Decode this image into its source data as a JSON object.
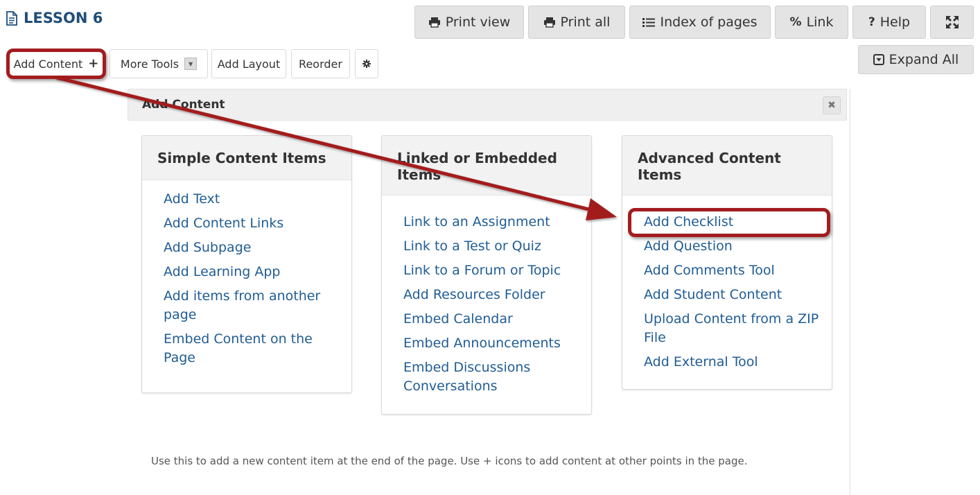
{
  "page": {
    "title": "LESSON 6"
  },
  "top_buttons": [
    {
      "label": "Print view"
    },
    {
      "label": "Print all"
    },
    {
      "label": "Index of pages"
    },
    {
      "label": "Link"
    },
    {
      "label": "Help"
    },
    {
      "label": "",
      "icon": "fullscreen-icon"
    }
  ],
  "toolbar": {
    "add_content": "Add Content",
    "more_tools": "More Tools",
    "add_layout": "Add Layout",
    "reorder": "Reorder",
    "settings_icon": "gear-icon",
    "expand_all": "Expand All"
  },
  "panel": {
    "title": "Add Content",
    "close_icon": "close-icon",
    "hint": "Use this to add a new content item at the end of the page. Use + icons to add content at other points in the page."
  },
  "columns": [
    {
      "title": "Simple Content Items",
      "items": [
        "Add Text",
        "Add Content Links",
        "Add Subpage",
        "Add Learning App",
        "Add items from another page",
        "Embed Content on the Page"
      ]
    },
    {
      "title": "Linked or Embedded Items",
      "items": [
        "Link to an Assignment",
        "Link to a Test or Quiz",
        "Link to a Forum or Topic",
        "Add Resources Folder",
        "Embed Calendar",
        "Embed Announcements",
        "Embed Discussions Conversations"
      ]
    },
    {
      "title": "Advanced Content Items",
      "items": [
        "Add Checklist",
        "Add Question",
        "Add Comments Tool",
        "Add Student Content",
        "Upload Content from a ZIP File",
        "Add External Tool"
      ]
    }
  ],
  "colors": {
    "title_blue": "#1f4e79",
    "link_blue": "#1f5c94",
    "annotation_red": "#a31c1f",
    "button_gray": "#e4e4e4",
    "panel_header_gray": "#efefef"
  }
}
